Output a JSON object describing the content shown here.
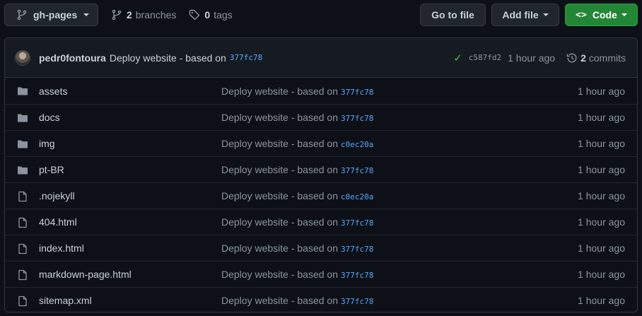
{
  "toolbar": {
    "branch": "gh-pages",
    "branches_count": "2",
    "branches_label": "branches",
    "tags_count": "0",
    "tags_label": "tags",
    "goto_file": "Go to file",
    "add_file": "Add file",
    "code": "Code",
    "code_color": "#238636"
  },
  "commit": {
    "author": "pedr0fontoura",
    "message": "Deploy website - based on",
    "message_sha": "377fc78",
    "short_sha": "c587fd2",
    "time": "1 hour ago",
    "commits_count": "2",
    "commits_label": "commits"
  },
  "files": [
    {
      "type": "folder",
      "name": "assets",
      "message": "Deploy website - based on",
      "sha": "377fc78",
      "age": "1 hour ago"
    },
    {
      "type": "folder",
      "name": "docs",
      "message": "Deploy website - based on",
      "sha": "377fc78",
      "age": "1 hour ago"
    },
    {
      "type": "folder",
      "name": "img",
      "message": "Deploy website - based on",
      "sha": "c0ec20a",
      "age": "1 hour ago"
    },
    {
      "type": "folder",
      "name": "pt-BR",
      "message": "Deploy website - based on",
      "sha": "377fc78",
      "age": "1 hour ago"
    },
    {
      "type": "file",
      "name": ".nojekyll",
      "message": "Deploy website - based on",
      "sha": "c0ec20a",
      "age": "1 hour ago"
    },
    {
      "type": "file",
      "name": "404.html",
      "message": "Deploy website - based on",
      "sha": "377fc78",
      "age": "1 hour ago"
    },
    {
      "type": "file",
      "name": "index.html",
      "message": "Deploy website - based on",
      "sha": "377fc78",
      "age": "1 hour ago"
    },
    {
      "type": "file",
      "name": "markdown-page.html",
      "message": "Deploy website - based on",
      "sha": "377fc78",
      "age": "1 hour ago"
    },
    {
      "type": "file",
      "name": "sitemap.xml",
      "message": "Deploy website - based on",
      "sha": "377fc78",
      "age": "1 hour ago"
    }
  ]
}
